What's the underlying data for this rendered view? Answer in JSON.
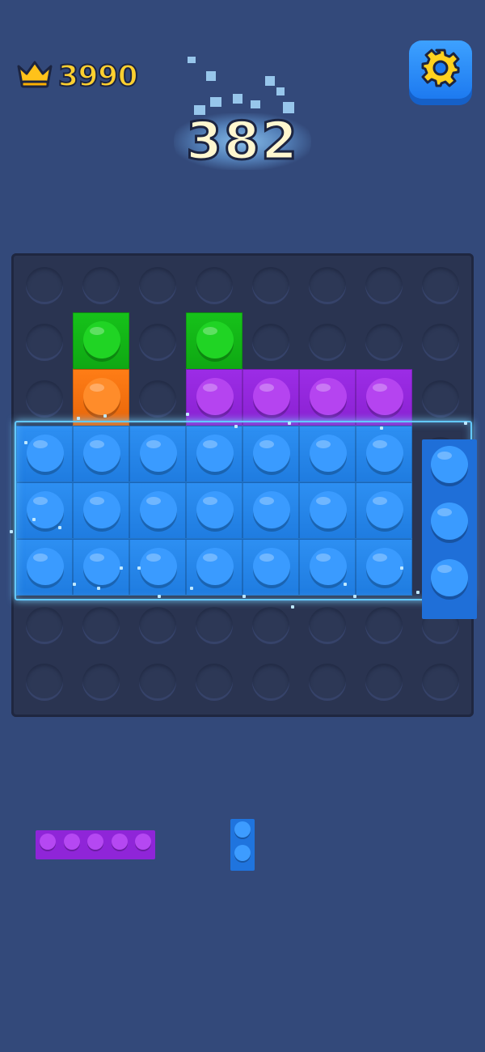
{
  "hud": {
    "best_score": "3990",
    "best_icon": "crown-icon",
    "score": "382",
    "settings_icon": "gear-icon"
  },
  "colors": {
    "background": "#33497a",
    "board": "#2a3451",
    "green": "#18c718",
    "orange": "#ff7a10",
    "purple": "#a32ee8",
    "blue": "#2e8ef0",
    "crown": "#ffc21a",
    "score_text": "#fff7cf"
  },
  "board": {
    "columns": 8,
    "rows": 8,
    "cells": [
      {
        "row": 1,
        "col": 1,
        "color": "green"
      },
      {
        "row": 2,
        "col": 1,
        "color": "orange"
      },
      {
        "row": 1,
        "col": 3,
        "color": "green"
      },
      {
        "row": 2,
        "col": 3,
        "color": "purple"
      },
      {
        "row": 2,
        "col": 4,
        "color": "purple"
      },
      {
        "row": 2,
        "col": 5,
        "color": "purple"
      },
      {
        "row": 2,
        "col": 6,
        "color": "purple"
      },
      {
        "row": 3,
        "col": 0,
        "color": "blue"
      },
      {
        "row": 3,
        "col": 1,
        "color": "blue"
      },
      {
        "row": 3,
        "col": 2,
        "color": "blue"
      },
      {
        "row": 3,
        "col": 3,
        "color": "blue"
      },
      {
        "row": 3,
        "col": 4,
        "color": "blue"
      },
      {
        "row": 3,
        "col": 5,
        "color": "blue"
      },
      {
        "row": 3,
        "col": 6,
        "color": "blue"
      },
      {
        "row": 4,
        "col": 0,
        "color": "blue"
      },
      {
        "row": 4,
        "col": 1,
        "color": "blue"
      },
      {
        "row": 4,
        "col": 2,
        "color": "blue"
      },
      {
        "row": 4,
        "col": 3,
        "color": "blue"
      },
      {
        "row": 4,
        "col": 4,
        "color": "blue"
      },
      {
        "row": 4,
        "col": 5,
        "color": "blue"
      },
      {
        "row": 4,
        "col": 6,
        "color": "blue"
      },
      {
        "row": 5,
        "col": 0,
        "color": "blue"
      },
      {
        "row": 5,
        "col": 1,
        "color": "blue"
      },
      {
        "row": 5,
        "col": 2,
        "color": "blue"
      },
      {
        "row": 5,
        "col": 3,
        "color": "blue"
      },
      {
        "row": 5,
        "col": 4,
        "color": "blue"
      },
      {
        "row": 5,
        "col": 5,
        "color": "blue"
      },
      {
        "row": 5,
        "col": 6,
        "color": "blue"
      }
    ],
    "dragging_piece": {
      "color": "blue",
      "orientation": "vertical",
      "length": 3
    }
  },
  "tray": [
    {
      "name": "tray-piece-purple-5",
      "color": "purple",
      "orientation": "horizontal",
      "length": 5
    },
    {
      "name": "tray-piece-blue-2",
      "color": "blue",
      "orientation": "vertical",
      "length": 2
    }
  ]
}
